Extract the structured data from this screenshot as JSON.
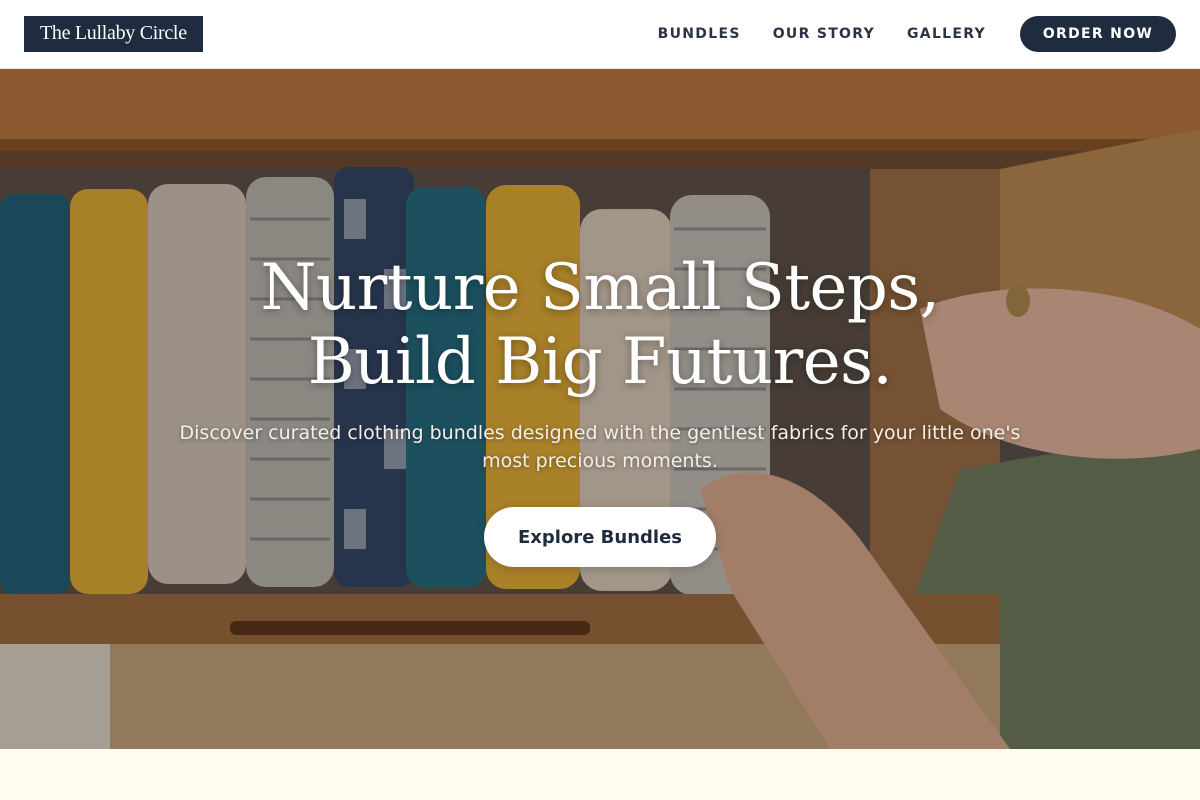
{
  "header": {
    "logo": "The Lullaby Circle",
    "nav": [
      {
        "label": "BUNDLES"
      },
      {
        "label": "OUR STORY"
      },
      {
        "label": "GALLERY"
      }
    ],
    "cta_label": "ORDER NOW"
  },
  "hero": {
    "title_line1": "Nurture Small Steps,",
    "title_line2": "Build Big Futures.",
    "subtitle": "Discover curated clothing bundles designed with the gentlest fabrics for your little one's most precious moments.",
    "cta_label": "Explore Bundles",
    "image_alt": "hand placing folded muslin baby blankets in a wooden drawer"
  },
  "colors": {
    "navy": "#1f2c40",
    "cream": "#fffcef",
    "white": "#ffffff"
  }
}
